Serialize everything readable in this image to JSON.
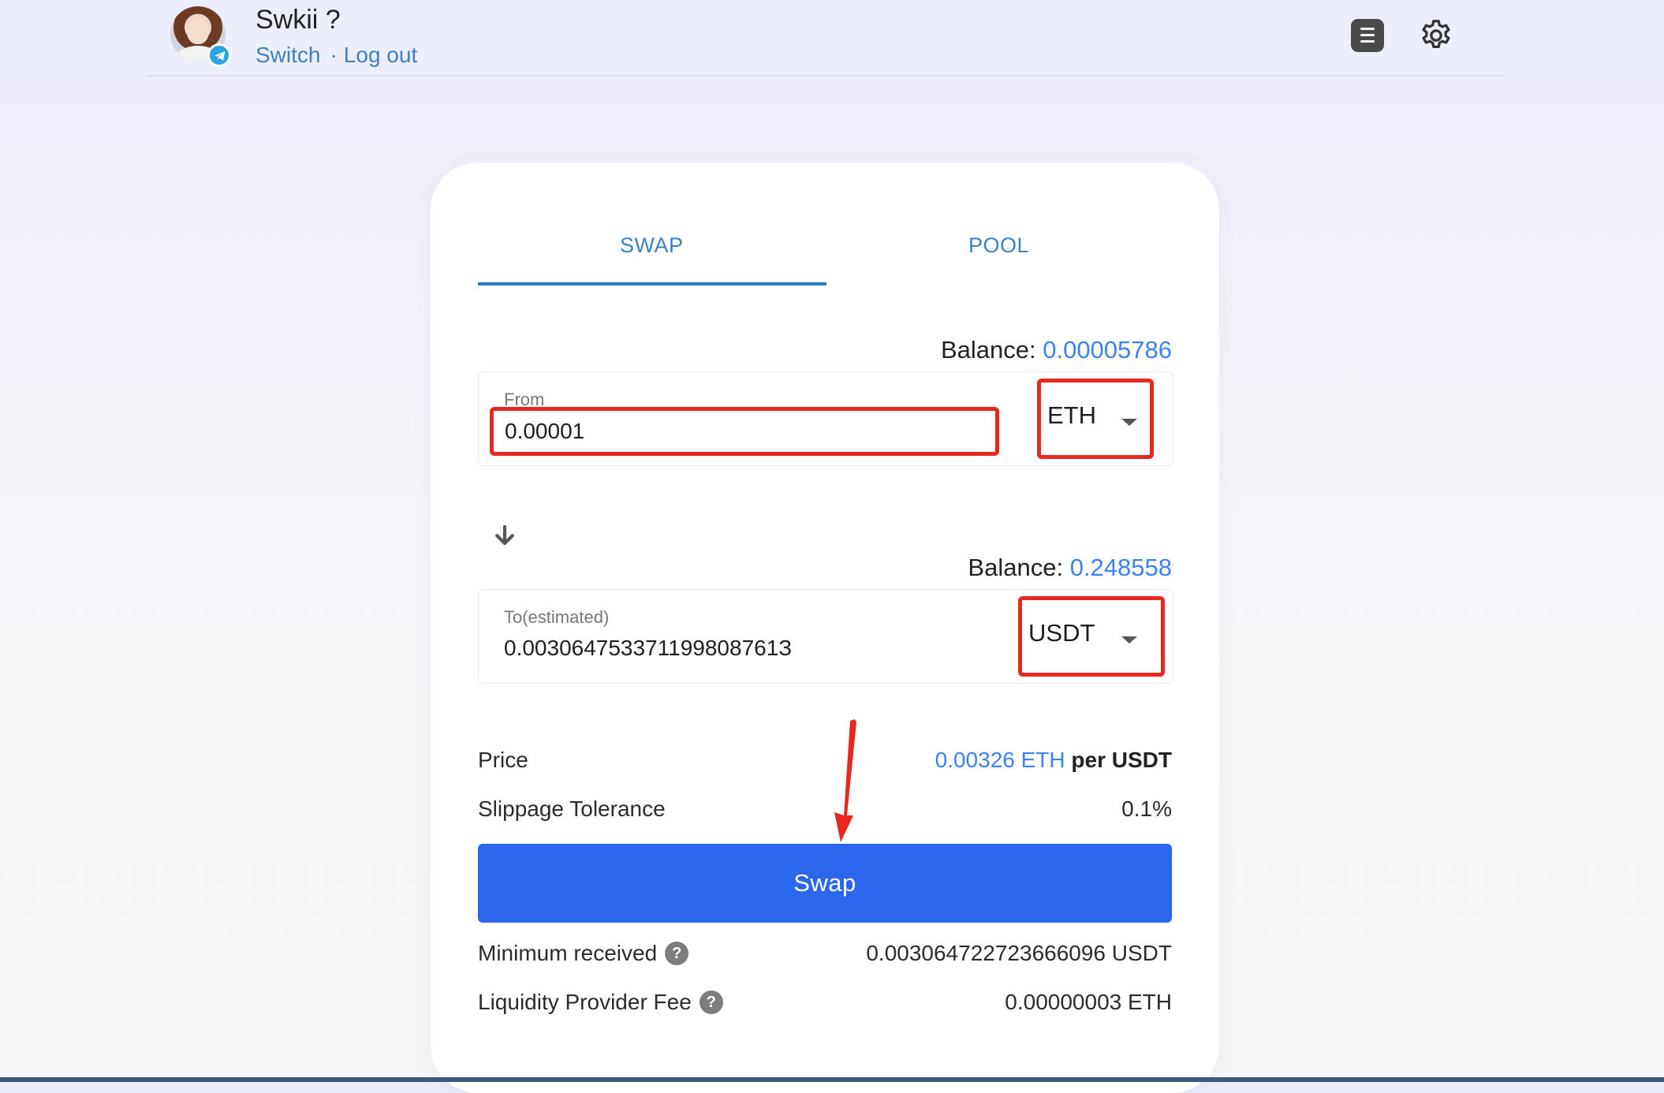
{
  "header": {
    "user_name": "Swkii ?",
    "switch_label": "Switch",
    "separator": "·",
    "logout_label": "Log out"
  },
  "tabs": {
    "swap_label": "SWAP",
    "pool_label": "POOL",
    "active": "SWAP"
  },
  "from": {
    "balance_label": "Balance:",
    "balance_value": "0.00005786",
    "field_label": "From",
    "amount": "0.00001",
    "token": "ETH"
  },
  "to": {
    "balance_label": "Balance:",
    "balance_value": "0.248558",
    "field_label": "To(estimated)",
    "amount": "0.003064753371199808761З",
    "token": "USDT"
  },
  "details": {
    "price_label": "Price",
    "price_amount": "0.00326",
    "price_unit": "ETH",
    "price_per": "per",
    "price_target": "USDT",
    "slippage_label": "Slippage Tolerance",
    "slippage_value": "0.1%",
    "min_received_label": "Minimum received",
    "min_received_value": "0.003064722723666096 USDT",
    "fee_label": "Liquidity Provider Fee",
    "fee_value": "0.00000003 ETH",
    "help_glyph": "?"
  },
  "actions": {
    "swap_button_label": "Swap"
  },
  "colors": {
    "accent_blue": "#3b82f6",
    "button_blue": "#2b67ec",
    "tab_blue": "#3b82c4",
    "highlight_red": "#e8281e",
    "telegram_blue": "#2aa3e1"
  },
  "icons": {
    "menu": "menu-icon",
    "settings": "gear-icon",
    "swap_direction": "arrow-down-icon",
    "dropdown": "caret-down-icon",
    "help": "help-icon",
    "telegram": "telegram-icon"
  }
}
